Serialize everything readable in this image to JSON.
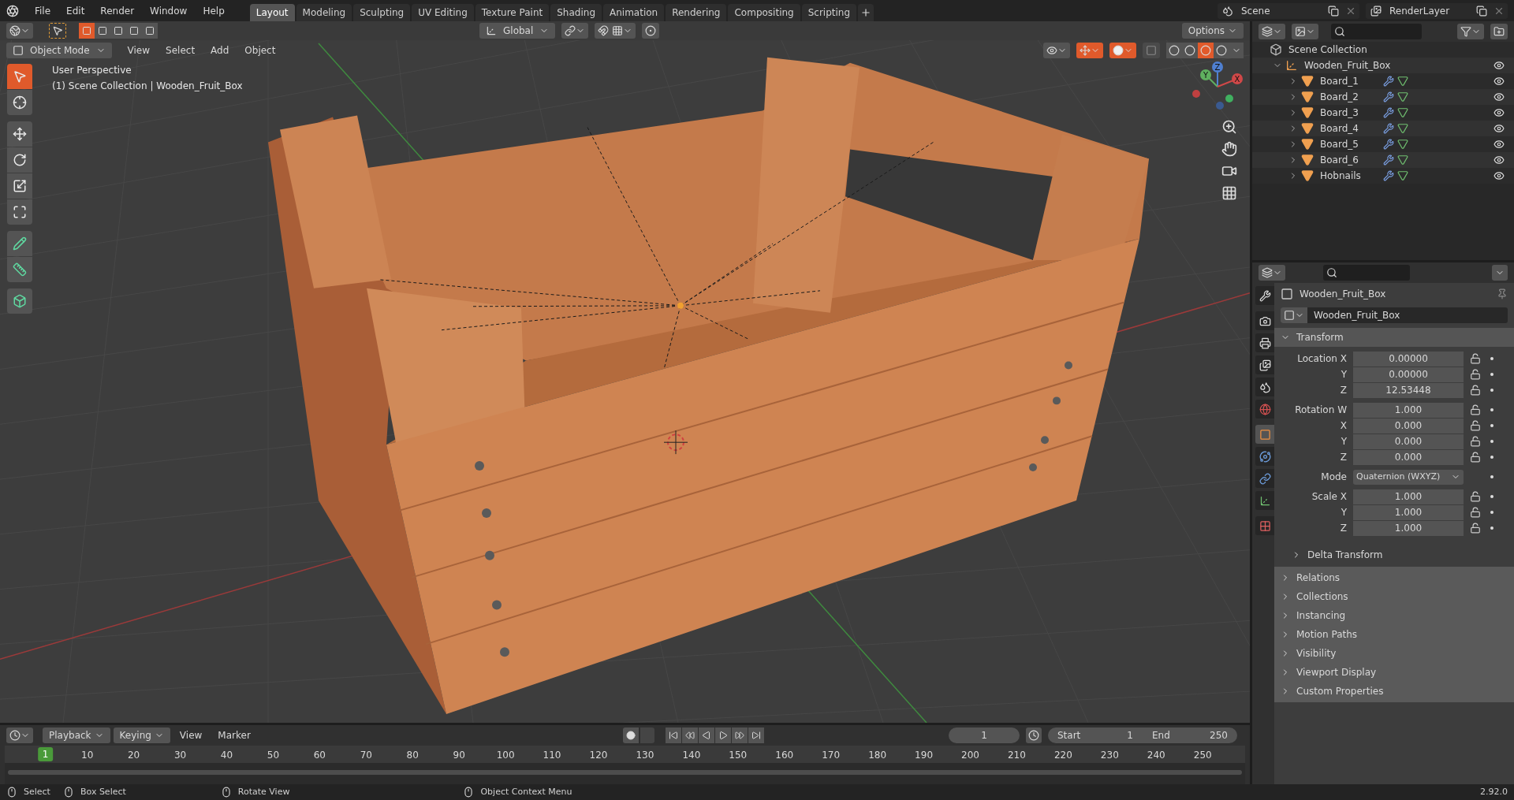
{
  "menu": [
    "File",
    "Edit",
    "Render",
    "Window",
    "Help"
  ],
  "workspaces": [
    {
      "label": "Layout",
      "selected": true
    },
    {
      "label": "Modeling",
      "selected": false
    },
    {
      "label": "Sculpting",
      "selected": false
    },
    {
      "label": "UV Editing",
      "selected": false
    },
    {
      "label": "Texture Paint",
      "selected": false
    },
    {
      "label": "Shading",
      "selected": false
    },
    {
      "label": "Animation",
      "selected": false
    },
    {
      "label": "Rendering",
      "selected": false
    },
    {
      "label": "Compositing",
      "selected": false
    },
    {
      "label": "Scripting",
      "selected": false
    }
  ],
  "scene": "Scene",
  "view_layer": "RenderLayer",
  "viewport": {
    "mode": "Object Mode",
    "menus": [
      "View",
      "Select",
      "Add",
      "Object"
    ],
    "orientation": "Global",
    "options": "Options",
    "overlay_text": [
      "User Perspective",
      "(1) Scene Collection | Wooden_Fruit_Box"
    ],
    "select_modes": [
      {
        "selected": true
      },
      {
        "selected": false
      },
      {
        "selected": false
      },
      {
        "selected": false
      },
      {
        "selected": false
      }
    ],
    "tools": [
      {
        "selected": true
      },
      {
        "selected": false
      },
      {
        "selected": false
      },
      {
        "selected": false
      },
      {
        "selected": false
      },
      {
        "selected": false
      },
      {
        "selected": false
      },
      {
        "selected": false
      },
      {
        "selected": false
      }
    ],
    "shading": [
      {
        "selected": false
      },
      {
        "selected": false
      },
      {
        "selected": true
      },
      {
        "selected": false
      }
    ],
    "toggles": {
      "gizmos": true,
      "overlays": true,
      "xray": false
    },
    "gizmo_axes": [
      "Z",
      "Y",
      "X"
    ]
  },
  "outliner": {
    "root": "Scene Collection",
    "items": [
      {
        "name": "Wooden_Fruit_Box",
        "expanded": true,
        "children": [
          {
            "name": "Board_1",
            "expanded": false
          },
          {
            "name": "Board_2",
            "expanded": false
          },
          {
            "name": "Board_3",
            "expanded": false
          },
          {
            "name": "Board_4",
            "expanded": false
          },
          {
            "name": "Board_5",
            "expanded": false
          },
          {
            "name": "Board_6",
            "expanded": false
          },
          {
            "name": "Hobnails",
            "expanded": false
          }
        ]
      }
    ]
  },
  "properties": {
    "tabs": [
      {
        "selected": false
      },
      {
        "selected": false
      },
      {
        "selected": false
      },
      {
        "selected": false
      },
      {
        "selected": false
      },
      {
        "selected": false
      },
      {
        "selected": true
      },
      {
        "selected": false
      },
      {
        "selected": false
      },
      {
        "selected": false
      },
      {
        "selected": false
      }
    ],
    "object_name": "Wooden_Fruit_Box",
    "datablock": "Wooden_Fruit_Box",
    "transform": {
      "title": "Transform",
      "expanded": true,
      "groups": [
        {
          "kind": "numbers",
          "rows": [
            {
              "label": "Location X",
              "value": "0.00000"
            },
            {
              "label": "Y",
              "value": "0.00000"
            },
            {
              "label": "Z",
              "value": "12.53448"
            }
          ]
        },
        {
          "kind": "numbers",
          "rows": [
            {
              "label": "Rotation W",
              "value": "1.000"
            },
            {
              "label": "X",
              "value": "0.000"
            },
            {
              "label": "Y",
              "value": "0.000"
            },
            {
              "label": "Z",
              "value": "0.000"
            }
          ]
        },
        {
          "kind": "dropdown",
          "label": "Mode",
          "value": "Quaternion (WXYZ)"
        },
        {
          "kind": "numbers",
          "rows": [
            {
              "label": "Scale X",
              "value": "1.000"
            },
            {
              "label": "Y",
              "value": "1.000"
            },
            {
              "label": "Z",
              "value": "1.000"
            }
          ]
        }
      ],
      "subpanels": [
        {
          "title": "Delta Transform",
          "expanded": false
        }
      ]
    },
    "panels": [
      {
        "title": "Relations",
        "expanded": false
      },
      {
        "title": "Collections",
        "expanded": false
      },
      {
        "title": "Instancing",
        "expanded": false
      },
      {
        "title": "Motion Paths",
        "expanded": false
      },
      {
        "title": "Visibility",
        "expanded": false
      },
      {
        "title": "Viewport Display",
        "expanded": false
      },
      {
        "title": "Custom Properties",
        "expanded": false
      }
    ]
  },
  "timeline": {
    "menus": [
      {
        "label": "Playback",
        "kind": "dropdown"
      },
      {
        "label": "Keying",
        "kind": "dropdown"
      },
      {
        "label": "View",
        "kind": "menu"
      },
      {
        "label": "Marker",
        "kind": "menu"
      }
    ],
    "current_frame": "1",
    "start_label": "Start",
    "start": "1",
    "end_label": "End",
    "end": "250",
    "playhead": "1",
    "ticks": [
      "10",
      "20",
      "30",
      "40",
      "50",
      "60",
      "70",
      "80",
      "90",
      "100",
      "110",
      "120",
      "130",
      "140",
      "150",
      "160",
      "170",
      "180",
      "190",
      "200",
      "210",
      "220",
      "230",
      "240",
      "250"
    ]
  },
  "status_bar": {
    "hints": [
      "Select",
      "Box Select",
      "Rotate View",
      "Object Context Menu"
    ],
    "version": "2.92.0"
  }
}
